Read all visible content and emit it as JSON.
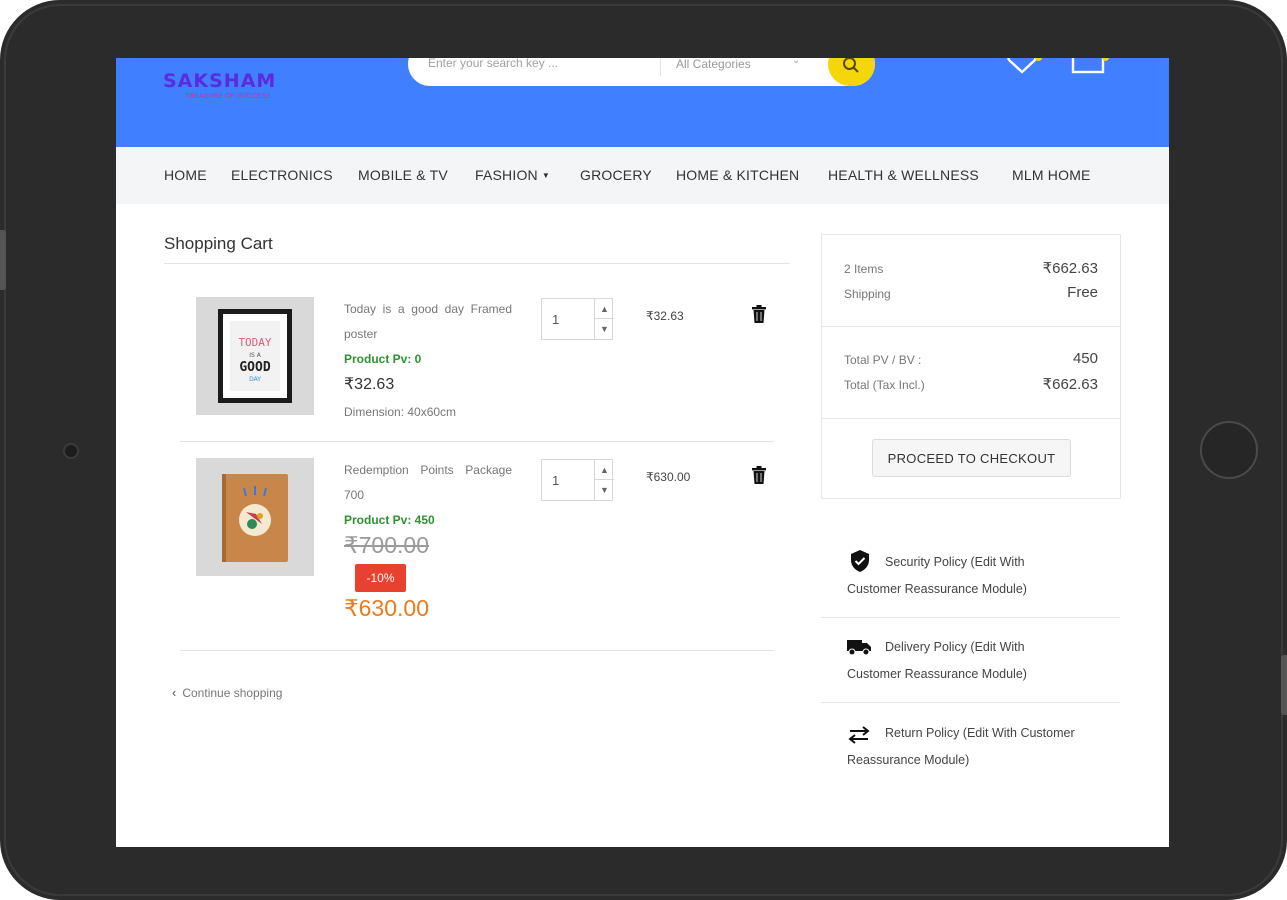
{
  "header": {
    "logo_text": "SAKSHAM",
    "logo_tagline": "TREASURE OF SUCCESS",
    "search_placeholder": "Enter your search key ...",
    "category_select": "All Categories"
  },
  "nav": {
    "items": [
      "HOME",
      "ELECTRONICS",
      "MOBILE & TV",
      "FASHION",
      "GROCERY",
      "HOME & KITCHEN",
      "HEALTH & WELLNESS",
      "MLM HOME"
    ]
  },
  "cart": {
    "title": "Shopping Cart",
    "items": [
      {
        "name": "Today is a good day Framed poster",
        "pv": "Product Pv: 0",
        "price": "₹32.63",
        "dimension": "Dimension: 40x60cm",
        "qty": "1",
        "line_total": "₹32.63",
        "thumb_text": [
          "TODAY",
          "IS A",
          "GOOD",
          "DAY"
        ]
      },
      {
        "name": "Redemption Points Package 700",
        "pv": "Product Pv: 450",
        "old_price": "₹700.00",
        "discount": "-10%",
        "price": "₹630.00",
        "qty": "1",
        "line_total": "₹630.00"
      }
    ],
    "continue_label": "Continue shopping"
  },
  "summary": {
    "items_label": "2 Items",
    "items_value": "₹662.63",
    "shipping_label": "Shipping",
    "shipping_value": "Free",
    "pv_label": "Total PV / BV :",
    "pv_value": "450",
    "total_label": "Total (Tax Incl.)",
    "total_value": "₹662.63",
    "checkout_label": "PROCEED TO CHECKOUT"
  },
  "policies": [
    {
      "icon": "shield-check-icon",
      "text": "Security Policy (Edit With Customer Reassurance Module)"
    },
    {
      "icon": "truck-icon",
      "text": "Delivery Policy (Edit With Customer Reassurance Module)"
    },
    {
      "icon": "swap-arrows-icon",
      "text": "Return Policy (Edit With Customer Reassurance Module)"
    }
  ],
  "colors": {
    "header_bg": "#407fff",
    "accent_yellow": "#f5d60a",
    "pv_green": "#2e9230",
    "discount_red": "#e8412f",
    "sale_orange": "#ee7a1a",
    "logo_purple": "#5b2bdf"
  }
}
